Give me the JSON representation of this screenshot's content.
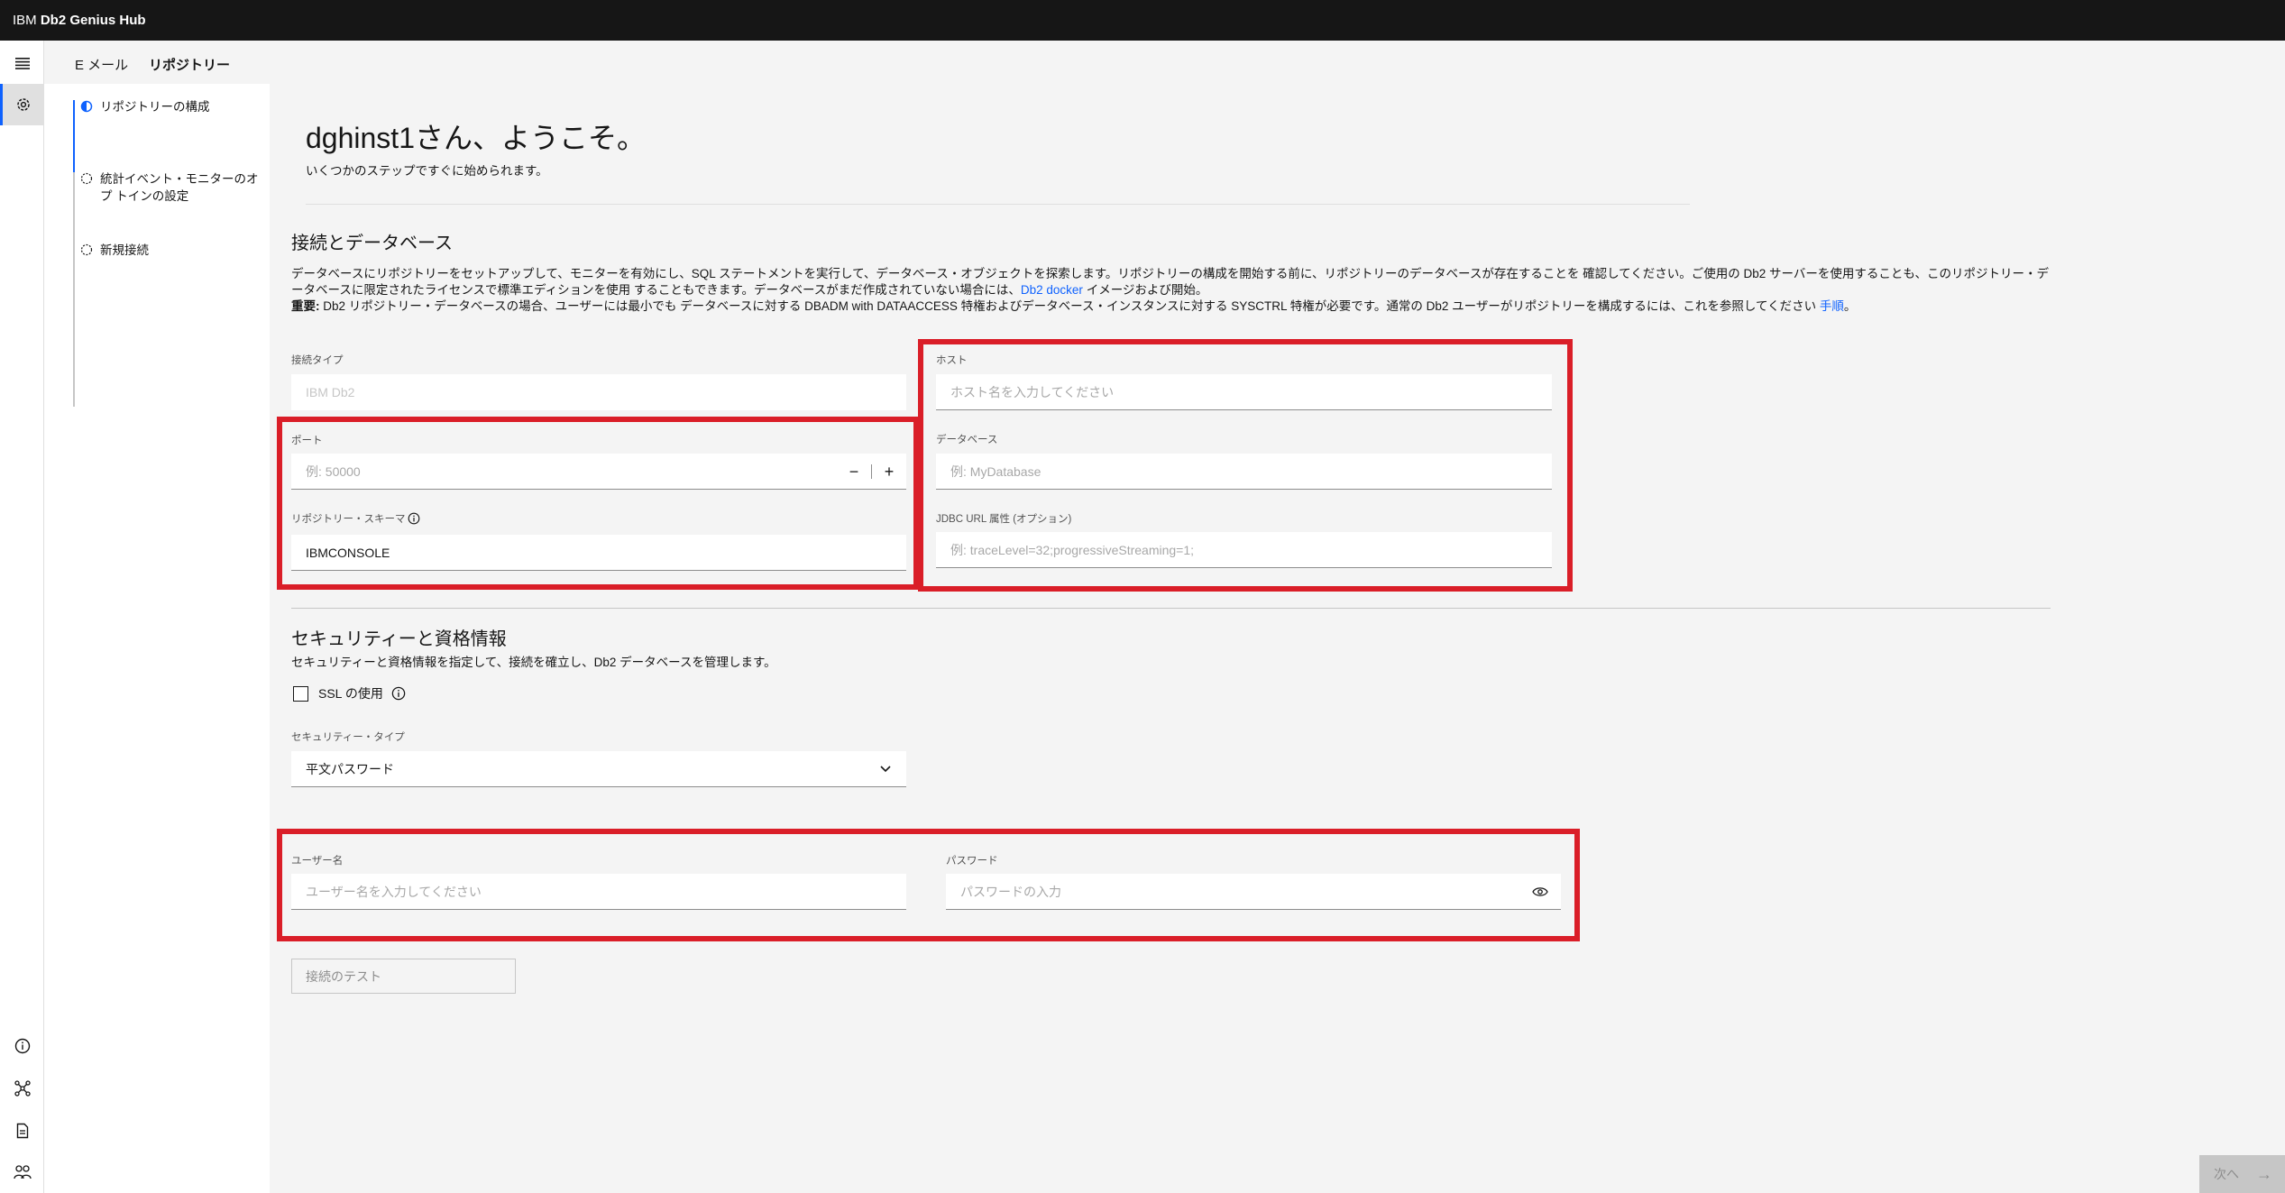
{
  "header": {
    "brand_prefix": "IBM",
    "brand_name": "Db2 Genius Hub"
  },
  "rail": {
    "top_icons": [
      "menu-icon",
      "settings-icon"
    ],
    "bottom_icons": [
      "info-icon",
      "network-icon",
      "document-icon",
      "users-icon"
    ]
  },
  "tabs": [
    {
      "label": "E メール"
    },
    {
      "label": "リポジトリー"
    }
  ],
  "progress": {
    "steps": [
      {
        "label": "リポジトリーの構成",
        "state": "current"
      },
      {
        "label": "統計イベント・モニターのオプ トインの設定",
        "state": "incomplete"
      },
      {
        "label": "新規接続",
        "state": "incomplete"
      }
    ]
  },
  "welcome": {
    "title": "dghinst1さん、ようこそ。",
    "subtitle": "いくつかのステップですぐに始められます。"
  },
  "connection": {
    "heading": "接続とデータベース",
    "desc_line1": "データベースにリポジトリーをセットアップして、モニターを有効にし、SQL ステートメントを実行して、データベース・オブジェクトを探索します。リポジトリーの構成を開始する前に、リポジトリーのデータベースが存在することを 確認してください。ご使用の Db2 サーバーを使用することも、このリポジトリー・データベースに限定されたライセンスで標準エディションを使用 することもできます。データベースがまだ作成されていない場合には、",
    "desc_link1": "Db2 docker",
    "desc_line1_end": " イメージおよび開始。",
    "desc_bold": "重要:",
    "desc_line2": " Db2 リポジトリー・データベースの場合、ユーザーには最小でも データベースに対する DBADM with DATAACCESS 特権およびデータベース・インスタンスに対する SYSCTRL 特権が必要です。通常の Db2 ユーザーがリポジトリーを構成するには、これを参照してください ",
    "desc_link2": "手順",
    "desc_line2_end": "。",
    "conn_type_label": "接続タイプ",
    "conn_type_value": "IBM Db2",
    "host_label": "ホスト",
    "host_placeholder": "ホスト名を入力してください",
    "port_label": "ポート",
    "port_placeholder": "例: 50000",
    "port_minus": "−",
    "port_plus": "+",
    "database_label": "データベース",
    "database_placeholder": "例: MyDatabase",
    "schema_label": "リポジトリー・スキーマ",
    "schema_value": "IBMCONSOLE",
    "jdbc_label": "JDBC URL 属性 (オプション)",
    "jdbc_placeholder": "例: traceLevel=32;progressiveStreaming=1;"
  },
  "security": {
    "heading": "セキュリティーと資格情報",
    "desc": "セキュリティーと資格情報を指定して、接続を確立し、Db2 データベースを管理します。",
    "ssl_label": "SSL の使用",
    "sec_type_label": "セキュリティー・タイプ",
    "sec_type_value": "平文パスワード",
    "user_label": "ユーザー名",
    "user_placeholder": "ユーザー名を入力してください",
    "pass_label": "パスワード",
    "pass_placeholder": "パスワードの入力"
  },
  "buttons": {
    "test": "接続のテスト",
    "next": "次へ"
  },
  "colors": {
    "header_bg": "#161616",
    "accent": "#0f62fe",
    "highlight_box": "#da1e28"
  }
}
